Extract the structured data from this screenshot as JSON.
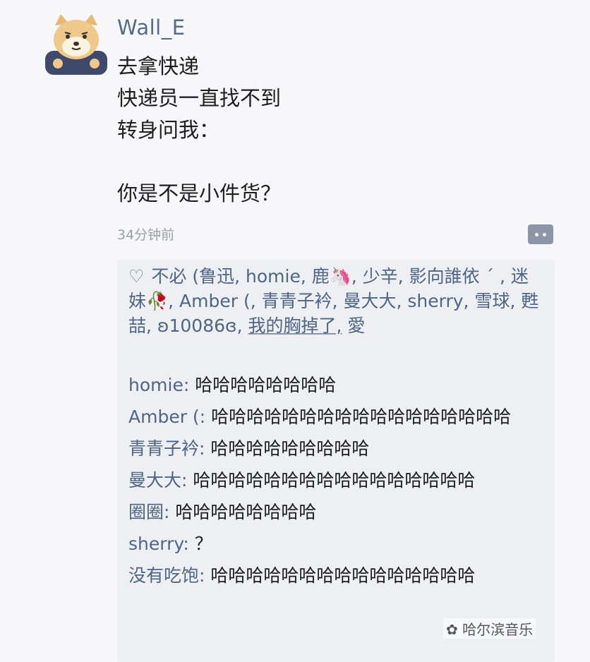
{
  "post": {
    "username": "Wall_E",
    "lines": [
      "去拿快递",
      "快递员一直找不到",
      "转身问我：",
      "",
      "你是不是小件货？"
    ],
    "time": "34分钟前"
  },
  "likes": {
    "icon": "heart-icon",
    "text": "不必 (鲁迅, homie, 鹿🦄, 少辛, 影向誰依 ˊ , 迷妹🥀, Amber (, 青青子衿, 曼大大, sherry, 雪球, 甦喆, ʚ10086ɞ, ",
    "underlined": "我的胸掉了,",
    "tail": " 愛"
  },
  "comments": [
    {
      "name": "homie",
      "text": "哈哈哈哈哈哈哈哈"
    },
    {
      "name": "Amber (",
      "text": "哈哈哈哈哈哈哈哈哈哈哈哈哈哈哈哈哈"
    },
    {
      "name": "青青子衿",
      "text": "哈哈哈哈哈哈哈哈哈"
    },
    {
      "name": "曼大大",
      "text": "哈哈哈哈哈哈哈哈哈哈哈哈哈哈哈哈"
    },
    {
      "name": "圈圈",
      "text": "哈哈哈哈哈哈哈哈"
    },
    {
      "name": "sherry",
      "text": "？"
    },
    {
      "name": "没有吃饱",
      "text": "哈哈哈哈哈哈哈哈哈哈哈哈哈哈哈"
    }
  ],
  "watermark": "哈尔滨音乐"
}
